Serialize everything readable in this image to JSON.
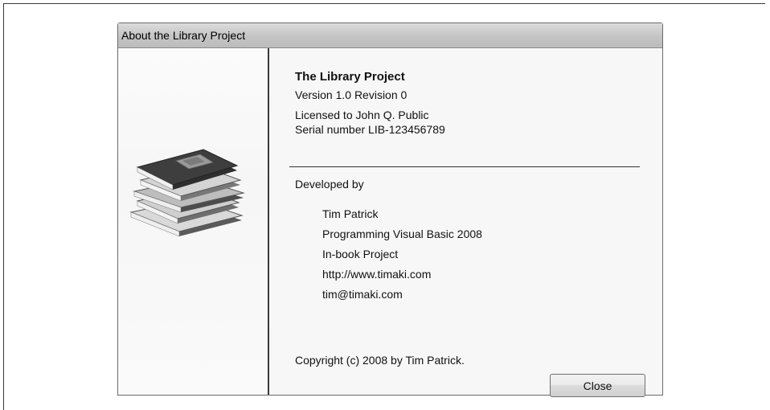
{
  "dialog": {
    "title": "About the Library Project",
    "product_name": "The Library Project",
    "version": "Version 1.0 Revision 0",
    "licensed_to": "Licensed to John Q. Public",
    "serial": "Serial number LIB-123456789",
    "developed_by_label": "Developed by",
    "developer_lines": [
      "Tim Patrick",
      "Programming Visual Basic 2008",
      "In-book Project",
      "http://www.timaki.com",
      "tim@timaki.com"
    ],
    "copyright": "Copyright (c) 2008 by Tim Patrick.",
    "close_label": "Close",
    "icon": "stack-of-books-icon"
  }
}
